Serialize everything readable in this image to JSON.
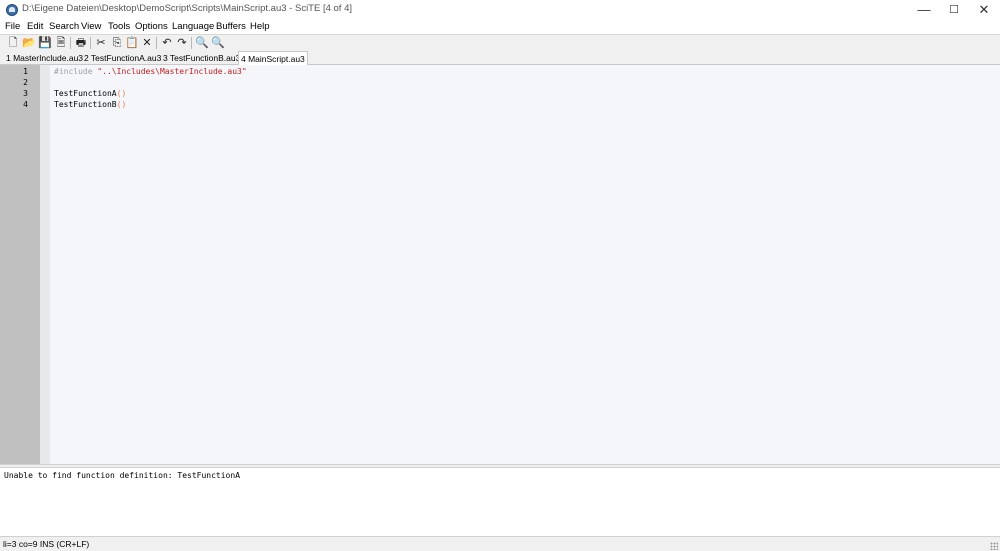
{
  "window": {
    "title": "D:\\Eigene Dateien\\Desktop\\DemoScript\\Scripts\\MainScript.au3 - SciTE [4 of 4]",
    "minimize": "—",
    "maximize": "☐",
    "close": "✕"
  },
  "menu": {
    "items": [
      "File",
      "Edit",
      "Search",
      "View",
      "Tools",
      "Options",
      "Language",
      "Buffers",
      "Help"
    ]
  },
  "toolbar": {
    "new": "🗋",
    "open": "📂",
    "save": "💾",
    "close_file": "🗎",
    "print": "🖶",
    "cut": "✂",
    "copy": "⎘",
    "paste": "📋",
    "delete": "✕",
    "undo": "↶",
    "redo": "↷",
    "find": "🔍",
    "replace": "🔍"
  },
  "tabs": [
    {
      "label": "1 MasterInclude.au3",
      "active": false
    },
    {
      "label": "2 TestFunctionA.au3",
      "active": false
    },
    {
      "label": "3 TestFunctionB.au3",
      "active": false
    },
    {
      "label": "4 MainScript.au3",
      "active": true
    }
  ],
  "editor": {
    "line_numbers": [
      "1",
      "2",
      "3",
      "4"
    ],
    "lines": [
      {
        "directive": "#include ",
        "string": "\"..\\Includes\\MasterInclude.au3\""
      },
      {},
      {
        "func": "TestFunctionA",
        "paren": "()"
      },
      {
        "func": "TestFunctionB",
        "paren": "()"
      }
    ]
  },
  "output": {
    "text": "Unable to find function definition: TestFunctionA"
  },
  "status": {
    "text": "li=3 co=9 INS (CR+LF)"
  },
  "colors": {
    "gutter": "#c0c0c0",
    "editor_bg": "#f4f6f9",
    "string": "#c02020",
    "directive": "#a0a0a0",
    "paren": "#e08050"
  }
}
